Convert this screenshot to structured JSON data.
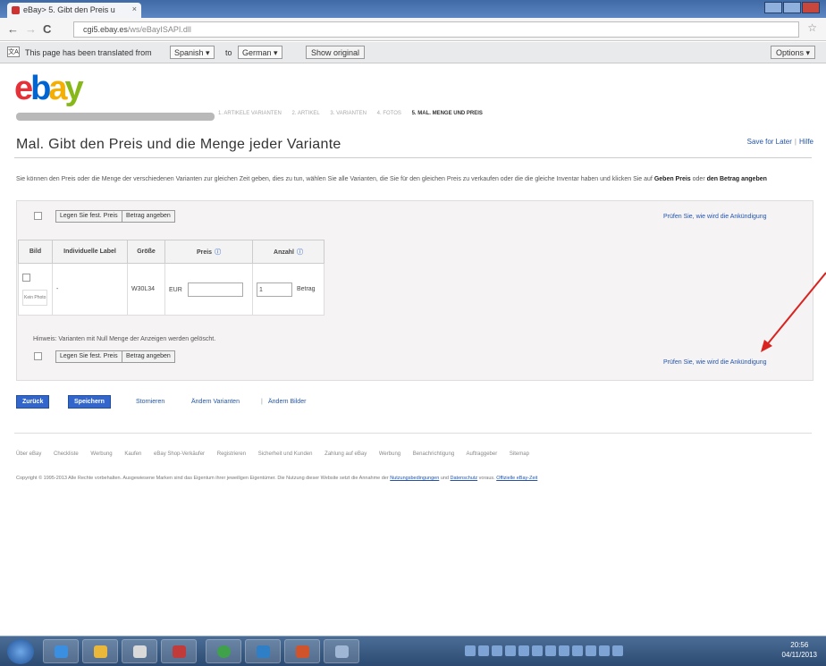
{
  "browser": {
    "tab_title": "eBay> 5. Gibt den Preis u",
    "tab_close": "×",
    "url_domain": "cgi5.ebay.es",
    "url_path": "/ws/eBayISAPI.dll",
    "back_glyph": "←",
    "forward_glyph": "→",
    "reload_glyph": "C",
    "star_glyph": "☆"
  },
  "translate_bar": {
    "message": "This page has been translated from",
    "from_lang": "Spanish ▾",
    "to_word": "to",
    "to_lang": "German ▾",
    "show_original": "Show original",
    "options": "Options ▾"
  },
  "header": {
    "logo": [
      "e",
      "b",
      "a",
      "y"
    ],
    "steps": [
      "1. ARTIKELE VARIANTEN",
      "2. ARTIKEL",
      "3. VARIANTEN",
      "4. FOTOS",
      "5. MAL. MENGE UND PREIS"
    ],
    "page_title": "Mal. Gibt den Preis und die Menge jeder Variante",
    "save_later": "Save for Later",
    "help": "Hilfe"
  },
  "intro": {
    "text": "Sie können den Preis oder die Menge der verschiedenen Varianten zur gleichen Zeit geben, dies zu tun, wählen Sie alle Varianten, die Sie für den gleichen Preis zu verkaufen oder die die gleiche Inventar haben und klicken Sie auf",
    "bold1": "Geben Preis",
    "mid": "oder",
    "bold2": "den Betrag angeben"
  },
  "bulk": {
    "set_price": "Legen Sie fest. Preis",
    "specify_amount": "Betrag angeben",
    "preview_link": "Prüfen Sie, wie wird die Ankündigung"
  },
  "table": {
    "headers": [
      "Bild",
      "Individuelle Label",
      "Größe",
      "Preis",
      "Anzahl"
    ],
    "row": {
      "photo": "Kein Photo",
      "label": "-",
      "size": "W30L34",
      "currency": "EUR",
      "price": "",
      "quantity": "1",
      "amount_label": "Betrag"
    }
  },
  "notice": "Hinweis: Varianten mit Null Menge der Anzeigen werden gelöscht.",
  "actions": {
    "back": "Zurück",
    "save": "Speichern",
    "cancel": "Stornieren",
    "change_variants": "Ändern Varianten",
    "sep": "|",
    "change_images": "Ändern Bilder"
  },
  "footer": {
    "links": [
      "Über eBay",
      "Checkliste",
      "Werbung",
      "Kaufen",
      "eBay Shop-Verkäufer",
      "Registrieren",
      "Sicherheit und Kunden",
      "Zahlung auf eBay",
      "Werbung",
      "Benachrichtigung",
      "Auftraggeber",
      "Sitemap"
    ],
    "copyright_pre": "Copyright © 1995-2013 Alle Rechte vorbehalten. Ausgewiesene Marken sind das Eigentum ihrer jeweiligen Eigentümer. Die Nutzung dieser Website setzt die Annahme der",
    "terms": "Nutzungsbedingungen",
    "and": "und",
    "privacy": "Datenschutz",
    "official_pre": "voraus.",
    "official": "Offizielle eBay-Zeit"
  },
  "taskbar": {
    "clock_time": "20:56",
    "clock_date": "04/11/2013"
  },
  "colors": {
    "ebay_red": "#e53238",
    "ebay_blue": "#0064d2",
    "ebay_yellow": "#f5af02",
    "ebay_green": "#86b817",
    "annotation_arrow": "#d8231f",
    "primary_button": "#3366cc"
  }
}
